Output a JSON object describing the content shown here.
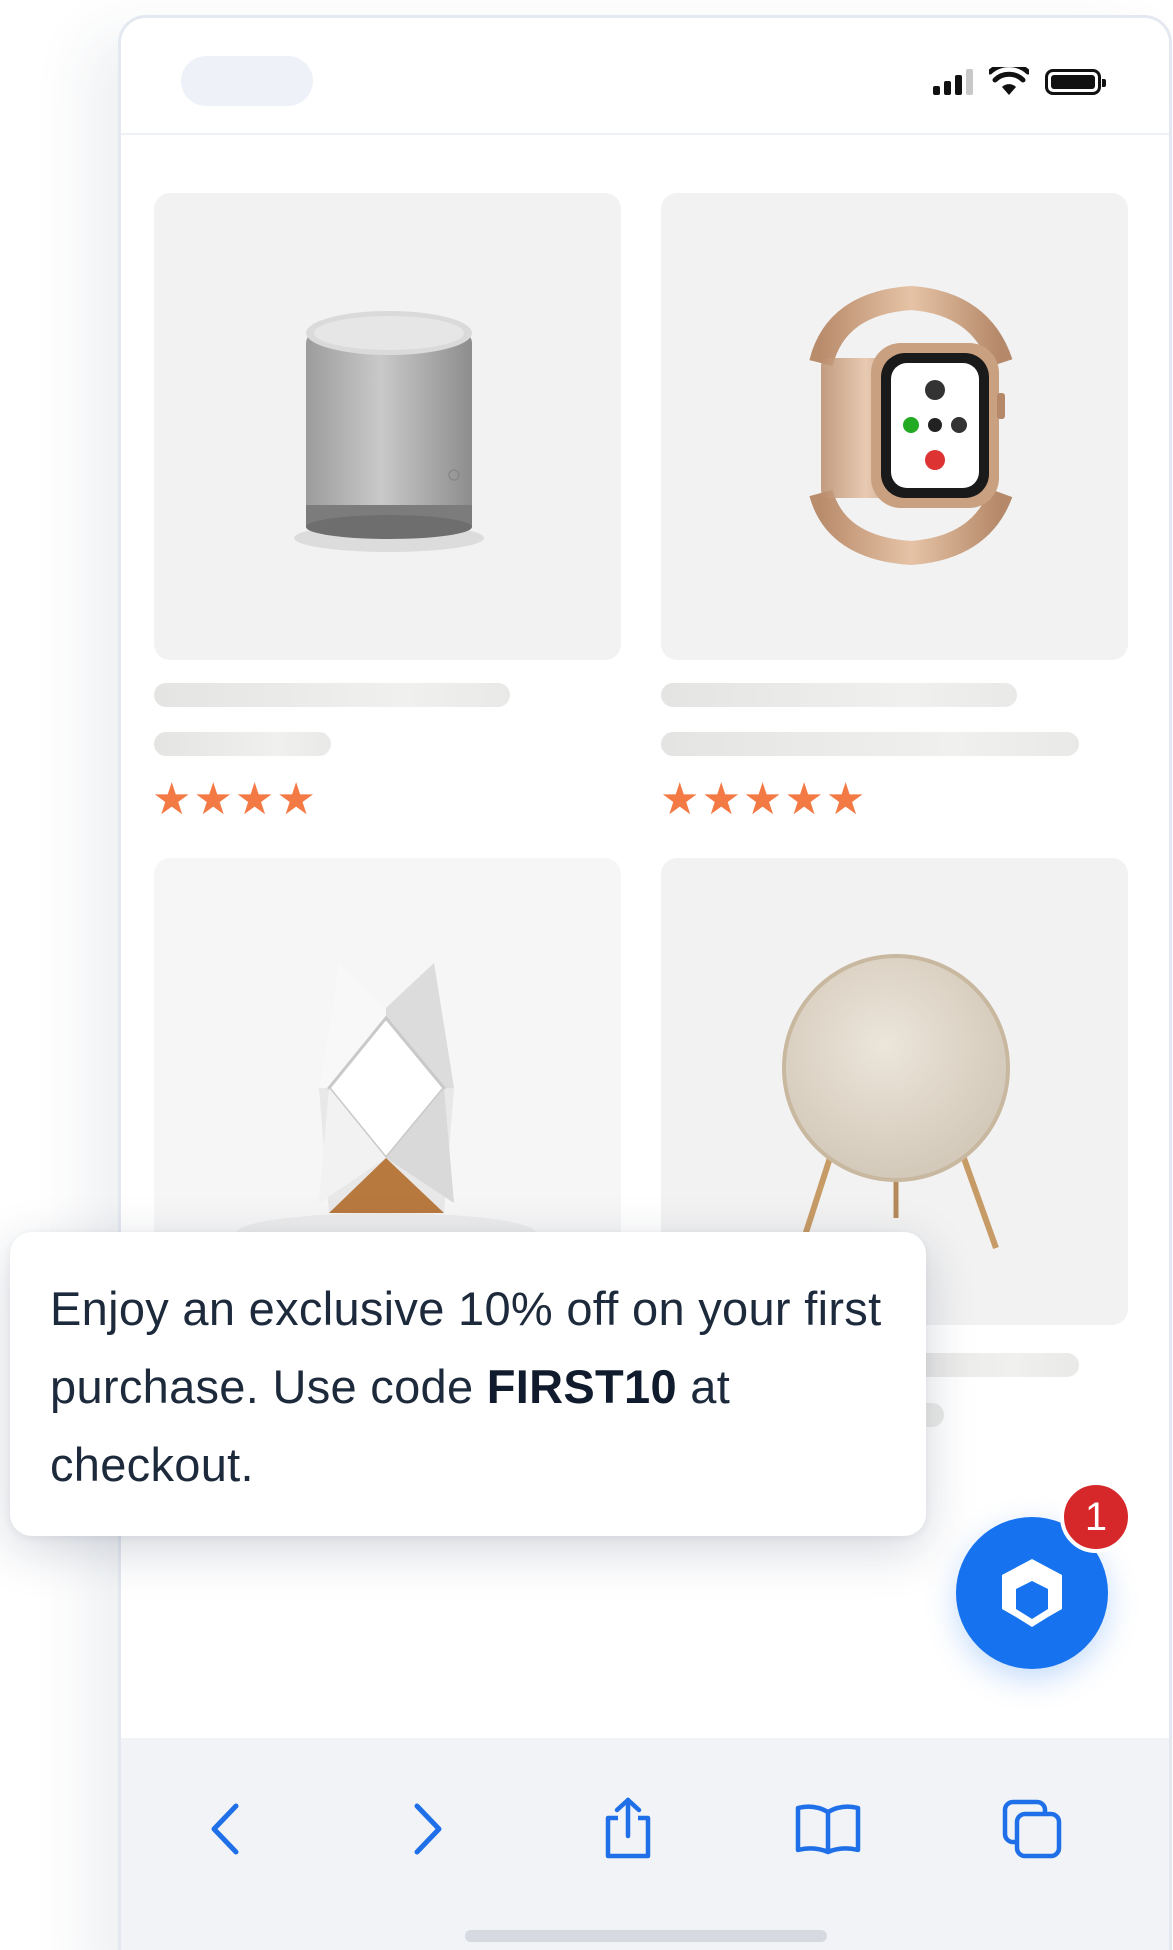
{
  "products": [
    {
      "rating": 4,
      "star_glyph": "★"
    },
    {
      "rating": 5,
      "star_glyph": "★"
    },
    {
      "rating": null
    },
    {
      "rating": null
    }
  ],
  "promo": {
    "text_before": "Enjoy an exclusive 10% off on your first purchase. Use code ",
    "code": "FIRST10",
    "text_after": " at checkout."
  },
  "fab": {
    "icon": "box-icon",
    "badge_count": "1"
  },
  "toolbar": {
    "icons": [
      "back-chevron-icon",
      "forward-chevron-icon",
      "share-icon",
      "bookmarks-icon",
      "tabs-icon"
    ]
  },
  "status_bar": {
    "icons": [
      "signal-icon",
      "wifi-icon",
      "battery-icon"
    ]
  },
  "colors": {
    "accent": "#1672ee",
    "star": "#f47a45",
    "badge": "#d6282b",
    "toolbar_icon": "#1e6fe8"
  }
}
